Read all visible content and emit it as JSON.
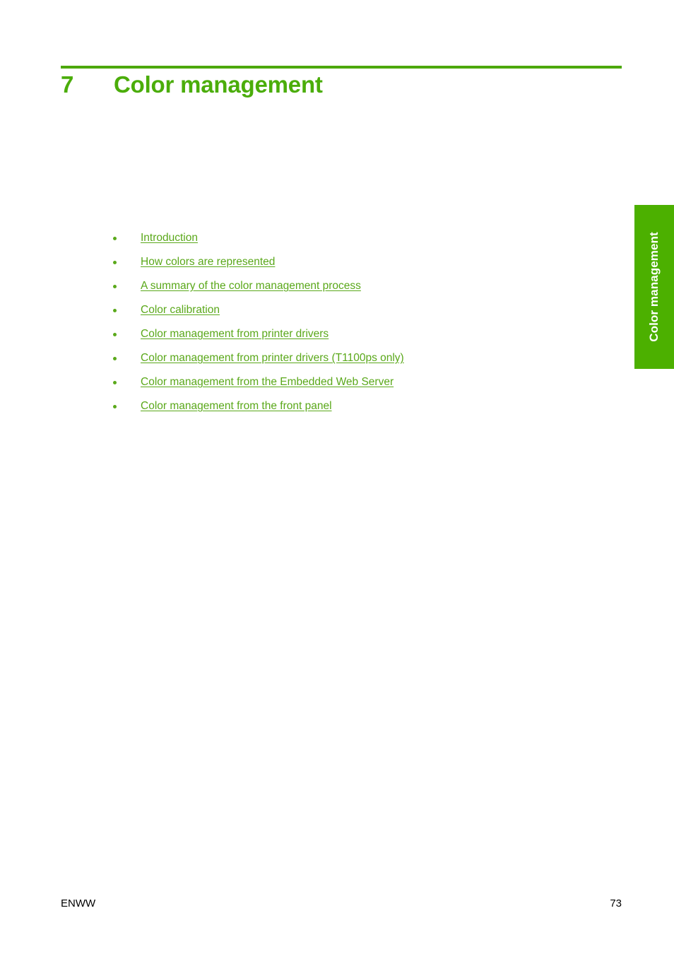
{
  "document": {
    "chapter_number": "7",
    "chapter_title": "Color management"
  },
  "side_tab": {
    "label": "Color management",
    "background_color": "#4cb000",
    "text_color": "#ffffff"
  },
  "colors": {
    "heading_green": "#4bad0a",
    "rule_green": "#4ca808",
    "link_green": "#5aa81a",
    "bullet_green": "#5aa91b",
    "footer_text": "#000000",
    "page_background": "#ffffff"
  },
  "toc": {
    "items": [
      {
        "label": "Introduction"
      },
      {
        "label": "How colors are represented"
      },
      {
        "label": "A summary of the color management process"
      },
      {
        "label": "Color calibration"
      },
      {
        "label": "Color management from printer drivers"
      },
      {
        "label": "Color management from printer drivers (T1100ps only)"
      },
      {
        "label": "Color management from the Embedded Web Server"
      },
      {
        "label": "Color management from the front panel"
      }
    ]
  },
  "footer": {
    "locale_code": "ENWW",
    "page_number": "73"
  }
}
